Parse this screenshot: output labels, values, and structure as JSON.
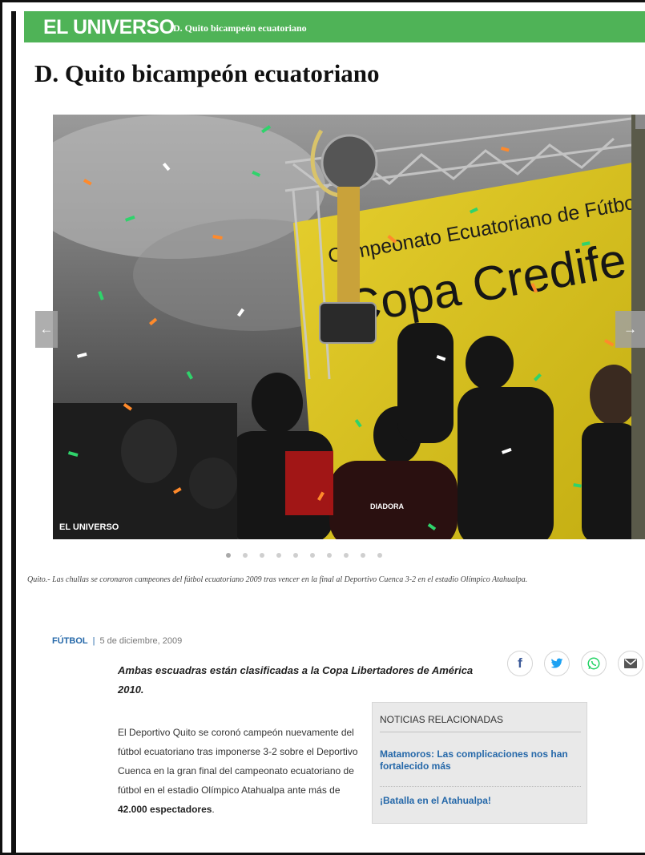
{
  "header": {
    "logo": "EL UNIVERSO",
    "title": "D. Quito bicampeón ecuatoriano",
    "accent_color": "#4fb357"
  },
  "article": {
    "headline": "D. Quito bicampeón ecuatoriano",
    "photo": {
      "watermark": "EL UNIVERSO",
      "banner_line1": "Campeonato Ecuatoriano de Fútbol",
      "banner_line2": "Copa Credife",
      "shirt_brand": "DIADORA",
      "prev_arrow": "←",
      "next_arrow": "→"
    },
    "gallery": {
      "dot_count": 10,
      "active_index": 0
    },
    "caption": "Quito.- Las chullas se coronaron campeones del fútbol ecuatoriano 2009 tras vencer en la final al Deportivo Cuenca 3-2 en el estadio Olímpico Atahualpa.",
    "section": "FÚTBOL",
    "separator": "|",
    "date": "5 de diciembre, 2009",
    "intro": "Ambas escuadras están clasificadas a la Copa Libertadores de América 2010.",
    "body_start": "El Deportivo Quito se coronó campeón nuevamente del fútbol ecuatoriano tras imponerse 3-2 sobre el Deportivo Cuenca en la gran final del campeonato ecuatoriano de fútbol en el estadio Olímpico Atahualpa ante más de ",
    "body_bold": "42.000 espectadores",
    "body_end": "."
  },
  "share": {
    "facebook_glyph": "f",
    "facebook_color": "#3b5998",
    "twitter_color": "#1da1f2",
    "whatsapp_color": "#25d366",
    "email_color": "#555555"
  },
  "related": {
    "title": "NOTICIAS RELACIONADAS",
    "links": [
      "Matamoros: Las complicaciones nos han fortalecido más",
      "¡Batalla en el Atahualpa!"
    ]
  }
}
